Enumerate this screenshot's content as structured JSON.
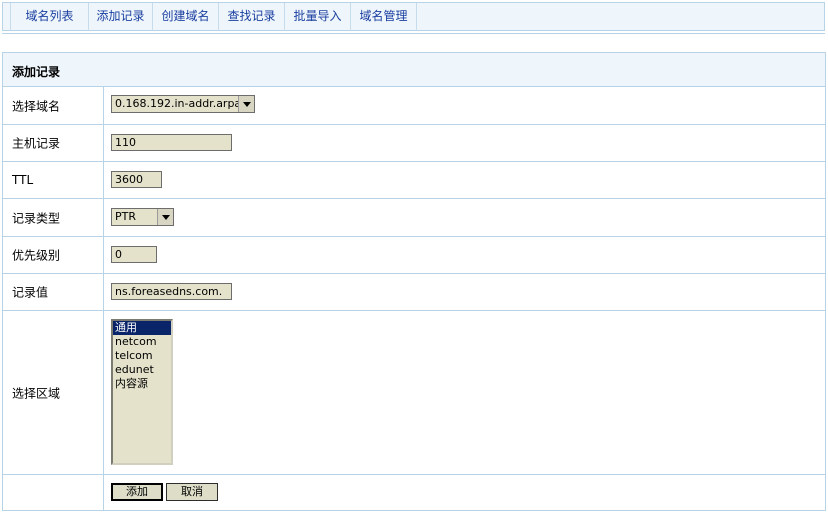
{
  "nav": {
    "tabs": [
      {
        "label": "域名列表"
      },
      {
        "label": "添加记录"
      },
      {
        "label": "创建域名"
      },
      {
        "label": "查找记录"
      },
      {
        "label": "批量导入"
      },
      {
        "label": "域名管理"
      }
    ]
  },
  "form": {
    "title": "添加记录",
    "domain": {
      "label": "选择域名",
      "value": "0.168.192.in-addr.arpa"
    },
    "host": {
      "label": "主机记录",
      "value": "110"
    },
    "ttl": {
      "label": "TTL",
      "value": "3600"
    },
    "type": {
      "label": "记录类型",
      "value": "PTR"
    },
    "priority": {
      "label": "优先级别",
      "value": "0"
    },
    "record_value": {
      "label": "记录值",
      "value": "ns.foreasedns.com."
    },
    "region": {
      "label": "选择区域",
      "options": [
        "通用",
        "netcom",
        "telcom",
        "edunet",
        "内容源"
      ],
      "selected": "通用"
    },
    "buttons": {
      "add": "添加",
      "cancel": "取消"
    }
  }
}
